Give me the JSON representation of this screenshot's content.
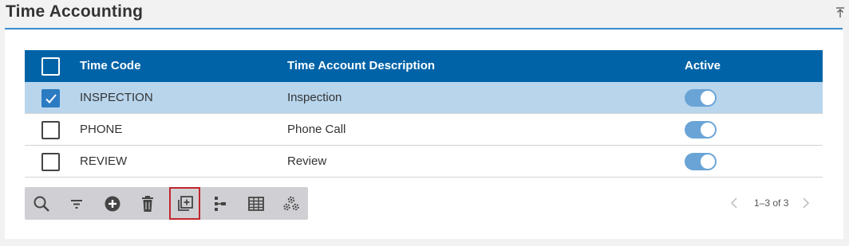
{
  "page": {
    "title": "Time Accounting",
    "collapse_icon": "collapse-up-icon"
  },
  "grid": {
    "columns": {
      "code": "Time Code",
      "description": "Time Account Description",
      "active": "Active"
    },
    "rows": [
      {
        "code": "INSPECTION",
        "description": "Inspection",
        "active": true,
        "selected": true
      },
      {
        "code": "PHONE",
        "description": "Phone Call",
        "active": true,
        "selected": false
      },
      {
        "code": "REVIEW",
        "description": "Review",
        "active": true,
        "selected": false
      }
    ]
  },
  "toolbar": {
    "tools": [
      {
        "name": "search-icon"
      },
      {
        "name": "filter-icon"
      },
      {
        "name": "add-icon"
      },
      {
        "name": "delete-icon"
      },
      {
        "name": "copy-add-icon",
        "active": true
      },
      {
        "name": "hierarchy-icon"
      },
      {
        "name": "grid-view-icon"
      },
      {
        "name": "settings-icon"
      }
    ]
  },
  "pager": {
    "info": "1–3 of 3",
    "prev": "‹",
    "next": "›"
  },
  "colors": {
    "header_bg": "#0063a8",
    "selected_row": "#b8d5ec",
    "toggle_on": "#6aa4d6",
    "accent_rule": "#3d8fd4",
    "active_tool_outline": "#c0272d"
  }
}
